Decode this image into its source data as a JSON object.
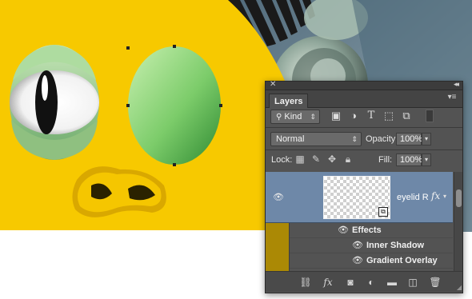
{
  "panel": {
    "tab_label": "Layers",
    "filter": {
      "kind_label": "Kind"
    },
    "blend_mode": "Normal",
    "opacity": {
      "label": "Opacity:",
      "value": "100%"
    },
    "lock": {
      "label": "Lock:"
    },
    "fill": {
      "label": "Fill:",
      "value": "100%"
    },
    "layer": {
      "name": "eyelid R",
      "fx": "fx"
    },
    "effects": [
      {
        "label": "Effects"
      },
      {
        "label": "Inner Shadow"
      },
      {
        "label": "Gradient Overlay"
      }
    ]
  },
  "icons": {
    "close": "close-icon",
    "collapse": "collapse-icon",
    "panel_menu": "panel-menu-icon",
    "filters": [
      "pixel-layer-filter-icon",
      "adjustment-layer-filter-icon",
      "type-layer-filter-icon",
      "shape-layer-filter-icon",
      "smart-object-filter-icon"
    ],
    "locks": [
      "lock-transparent-pixels-icon",
      "lock-image-pixels-icon",
      "lock-position-icon",
      "lock-all-icon"
    ],
    "bottom": [
      "link-layers-icon",
      "add-layer-style-icon",
      "add-mask-icon",
      "new-adjustment-layer-icon",
      "new-group-icon",
      "new-layer-icon",
      "delete-layer-icon"
    ]
  },
  "colors": {
    "canvas_yellow": "#f7c900",
    "panel_bg": "#535353",
    "selected_row": "#6e88a8",
    "layer_color_tag": "#ab8905"
  }
}
